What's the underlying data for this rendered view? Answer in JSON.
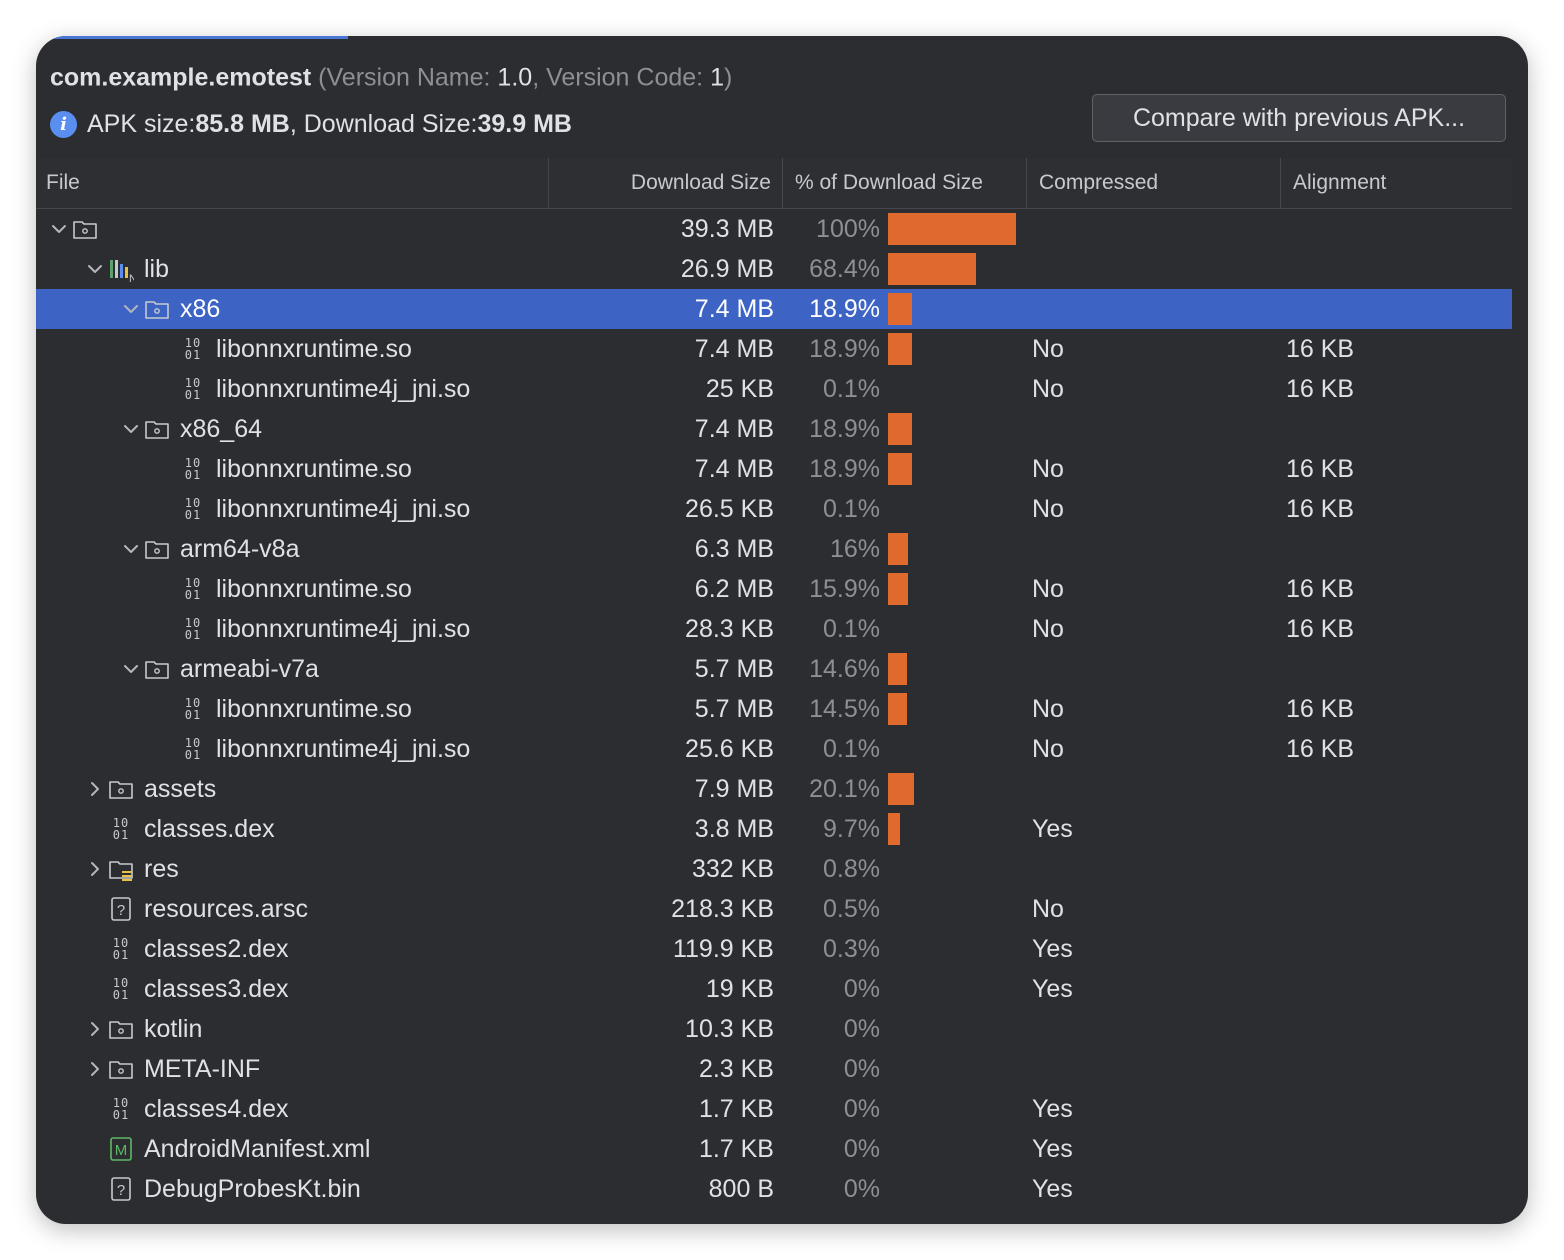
{
  "header": {
    "package": "com.example.emotest",
    "version_prefix": "(Version Name: ",
    "version_name": "1.0",
    "version_mid": ", Version Code: ",
    "version_code": "1",
    "version_suffix": ")"
  },
  "summary": {
    "apk_label": "APK size: ",
    "apk_value": "85.8 MB",
    "download_label": ", Download Size: ",
    "download_value": "39.9 MB"
  },
  "compare_button": "Compare with previous APK...",
  "columns": [
    "File",
    "Download Size",
    "% of Download Size",
    "Compressed",
    "Alignment"
  ],
  "accent": {
    "bar": "#e06a2e",
    "selection": "#3d63c4"
  },
  "rows": [
    {
      "name": "",
      "icon": "folder",
      "chevron": "down",
      "depth": 0,
      "size": "39.3 MB",
      "pct": "100%",
      "bar": 1.0,
      "compressed": "",
      "alignment": ""
    },
    {
      "name": "lib",
      "icon": "native-lib",
      "chevron": "down",
      "depth": 1,
      "size": "26.9 MB",
      "pct": "68.4%",
      "bar": 0.684,
      "compressed": "",
      "alignment": ""
    },
    {
      "name": "x86",
      "icon": "folder",
      "chevron": "down",
      "depth": 2,
      "size": "7.4 MB",
      "pct": "18.9%",
      "bar": 0.189,
      "compressed": "",
      "alignment": "",
      "selected": true
    },
    {
      "name": "libonnxruntime.so",
      "icon": "binary",
      "chevron": "",
      "depth": 3,
      "size": "7.4 MB",
      "pct": "18.9%",
      "bar": 0.189,
      "compressed": "No",
      "alignment": "16 KB"
    },
    {
      "name": "libonnxruntime4j_jni.so",
      "icon": "binary",
      "chevron": "",
      "depth": 3,
      "size": "25 KB",
      "pct": "0.1%",
      "bar": 0,
      "compressed": "No",
      "alignment": "16 KB"
    },
    {
      "name": "x86_64",
      "icon": "folder",
      "chevron": "down",
      "depth": 2,
      "size": "7.4 MB",
      "pct": "18.9%",
      "bar": 0.189,
      "compressed": "",
      "alignment": ""
    },
    {
      "name": "libonnxruntime.so",
      "icon": "binary",
      "chevron": "",
      "depth": 3,
      "size": "7.4 MB",
      "pct": "18.9%",
      "bar": 0.189,
      "compressed": "No",
      "alignment": "16 KB"
    },
    {
      "name": "libonnxruntime4j_jni.so",
      "icon": "binary",
      "chevron": "",
      "depth": 3,
      "size": "26.5 KB",
      "pct": "0.1%",
      "bar": 0,
      "compressed": "No",
      "alignment": "16 KB"
    },
    {
      "name": "arm64-v8a",
      "icon": "folder",
      "chevron": "down",
      "depth": 2,
      "size": "6.3 MB",
      "pct": "16%",
      "bar": 0.16,
      "compressed": "",
      "alignment": ""
    },
    {
      "name": "libonnxruntime.so",
      "icon": "binary",
      "chevron": "",
      "depth": 3,
      "size": "6.2 MB",
      "pct": "15.9%",
      "bar": 0.159,
      "compressed": "No",
      "alignment": "16 KB"
    },
    {
      "name": "libonnxruntime4j_jni.so",
      "icon": "binary",
      "chevron": "",
      "depth": 3,
      "size": "28.3 KB",
      "pct": "0.1%",
      "bar": 0,
      "compressed": "No",
      "alignment": "16 KB"
    },
    {
      "name": "armeabi-v7a",
      "icon": "folder",
      "chevron": "down",
      "depth": 2,
      "size": "5.7 MB",
      "pct": "14.6%",
      "bar": 0.146,
      "compressed": "",
      "alignment": ""
    },
    {
      "name": "libonnxruntime.so",
      "icon": "binary",
      "chevron": "",
      "depth": 3,
      "size": "5.7 MB",
      "pct": "14.5%",
      "bar": 0.145,
      "compressed": "No",
      "alignment": "16 KB"
    },
    {
      "name": "libonnxruntime4j_jni.so",
      "icon": "binary",
      "chevron": "",
      "depth": 3,
      "size": "25.6 KB",
      "pct": "0.1%",
      "bar": 0,
      "compressed": "No",
      "alignment": "16 KB"
    },
    {
      "name": "assets",
      "icon": "folder",
      "chevron": "right",
      "depth": 1,
      "size": "7.9 MB",
      "pct": "20.1%",
      "bar": 0.201,
      "compressed": "",
      "alignment": ""
    },
    {
      "name": "classes.dex",
      "icon": "binary",
      "chevron": "",
      "depth": 1,
      "size": "3.8 MB",
      "pct": "9.7%",
      "bar": 0.097,
      "compressed": "Yes",
      "alignment": ""
    },
    {
      "name": "res",
      "icon": "res-folder",
      "chevron": "right",
      "depth": 1,
      "size": "332 KB",
      "pct": "0.8%",
      "bar": 0,
      "compressed": "",
      "alignment": ""
    },
    {
      "name": "resources.arsc",
      "icon": "unknown",
      "chevron": "",
      "depth": 1,
      "size": "218.3 KB",
      "pct": "0.5%",
      "bar": 0,
      "compressed": "No",
      "alignment": ""
    },
    {
      "name": "classes2.dex",
      "icon": "binary",
      "chevron": "",
      "depth": 1,
      "size": "119.9 KB",
      "pct": "0.3%",
      "bar": 0,
      "compressed": "Yes",
      "alignment": ""
    },
    {
      "name": "classes3.dex",
      "icon": "binary",
      "chevron": "",
      "depth": 1,
      "size": "19 KB",
      "pct": "0%",
      "bar": 0,
      "compressed": "Yes",
      "alignment": ""
    },
    {
      "name": "kotlin",
      "icon": "folder",
      "chevron": "right",
      "depth": 1,
      "size": "10.3 KB",
      "pct": "0%",
      "bar": 0,
      "compressed": "",
      "alignment": ""
    },
    {
      "name": "META-INF",
      "icon": "folder",
      "chevron": "right",
      "depth": 1,
      "size": "2.3 KB",
      "pct": "0%",
      "bar": 0,
      "compressed": "",
      "alignment": ""
    },
    {
      "name": "classes4.dex",
      "icon": "binary",
      "chevron": "",
      "depth": 1,
      "size": "1.7 KB",
      "pct": "0%",
      "bar": 0,
      "compressed": "Yes",
      "alignment": ""
    },
    {
      "name": "AndroidManifest.xml",
      "icon": "manifest",
      "chevron": "",
      "depth": 1,
      "size": "1.7 KB",
      "pct": "0%",
      "bar": 0,
      "compressed": "Yes",
      "alignment": ""
    },
    {
      "name": "DebugProbesKt.bin",
      "icon": "unknown",
      "chevron": "",
      "depth": 1,
      "size": "800 B",
      "pct": "0%",
      "bar": 0,
      "compressed": "Yes",
      "alignment": ""
    }
  ]
}
